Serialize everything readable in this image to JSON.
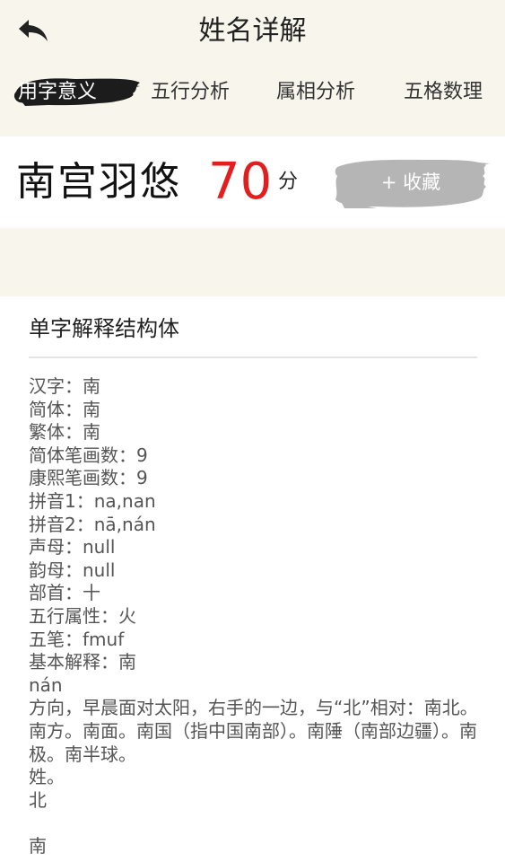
{
  "header": {
    "title": "姓名详解"
  },
  "tabs": [
    {
      "label": "用字意义",
      "active": true
    },
    {
      "label": "五行分析",
      "active": false
    },
    {
      "label": "属相分析",
      "active": false
    },
    {
      "label": "五格数理",
      "active": false
    }
  ],
  "score_card": {
    "name": "南宫羽悠",
    "score": "70",
    "unit": "分",
    "favorite_label": "+ 收藏"
  },
  "detail": {
    "section_title": "单字解释结构体",
    "lines": [
      "汉字：南",
      "简体：南",
      "繁体：南",
      "简体笔画数：9",
      "康熙笔画数：9",
      "拼音1：na,nan",
      "拼音2：nā,nán",
      "声母：null",
      "韵母：null",
      "部首：十",
      "五行属性：火",
      "五笔：fmuf",
      "基本解释：南",
      "nán",
      "方向，早晨面对太阳，右手的一边，与“北”相对：南北。南方。南面。南国（指中国南部）。南陲（南部边疆）。南极。南半球。",
      "姓。",
      "北",
      "",
      "南"
    ]
  },
  "colors": {
    "background": "#f8f6ec",
    "accent_red": "#e41e1e",
    "ink_black": "#1a1a1a",
    "ink_gray": "#b5b5b5"
  }
}
